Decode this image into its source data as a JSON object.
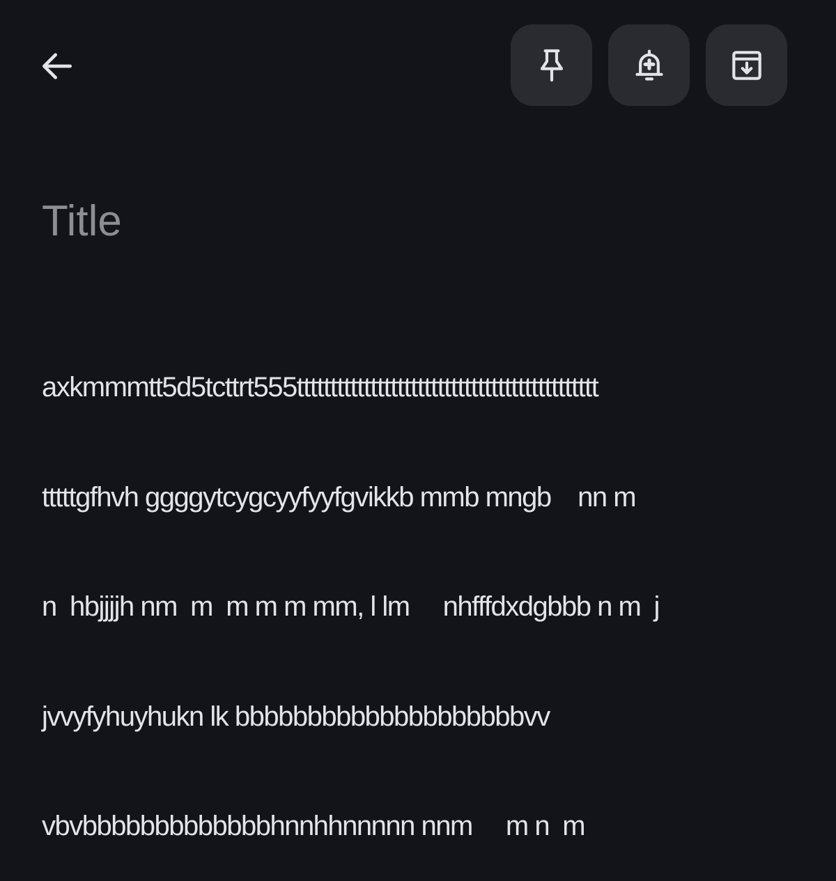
{
  "toolbar": {
    "back_icon": "arrow-back-icon",
    "actions": [
      {
        "name": "pin-button",
        "icon": "pin-icon"
      },
      {
        "name": "reminder-button",
        "icon": "bell-plus-icon"
      },
      {
        "name": "archive-button",
        "icon": "archive-icon"
      }
    ]
  },
  "note": {
    "title_placeholder": "Title",
    "body_lines": [
      "axkmmmtt5d5tcttrt555ttttttttttttttttttttttttttttttttttttttttttttt",
      "tttttgfhvh ggggytcygcyyfyyfgvikkb mmb mngb    nn m",
      "n  hbjjjjh nm  m  m m m mm, l lm     nhfffdxdgbbb n m  j",
      "jvvyfyhuyhukn lk bbbbbbbbbbbbbbbbbbbbvv",
      "vbvbbbbbbbbbbbbbhnnhhnnnnn nnm     m n  m"
    ]
  },
  "colors": {
    "background": "#131419",
    "button_bg": "#2a2b30",
    "text": "#e3e3e8",
    "placeholder": "#8d8e93",
    "icon": "#e3e3e8"
  }
}
